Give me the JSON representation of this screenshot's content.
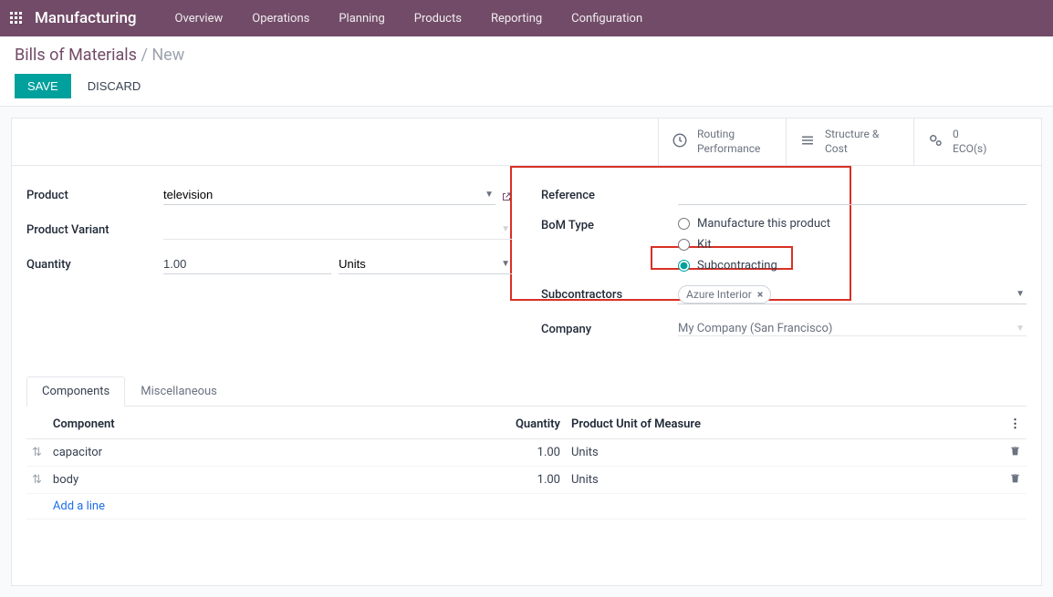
{
  "nav": {
    "brand": "Manufacturing",
    "items": [
      "Overview",
      "Operations",
      "Planning",
      "Products",
      "Reporting",
      "Configuration"
    ]
  },
  "breadcrumb": {
    "parent": "Bills of Materials",
    "current": "New"
  },
  "actions": {
    "save": "Save",
    "discard": "Discard"
  },
  "stats": {
    "routing": {
      "l1": "Routing",
      "l2": "Performance"
    },
    "structure": {
      "l1": "Structure &",
      "l2": "Cost"
    },
    "eco": {
      "l1": "0",
      "l2": "ECO(s)"
    }
  },
  "form": {
    "left": {
      "product_label": "Product",
      "product_value": "television",
      "variant_label": "Product Variant",
      "variant_value": "",
      "qty_label": "Quantity",
      "qty_value": "1.00",
      "qty_uom": "Units"
    },
    "right": {
      "reference_label": "Reference",
      "reference_value": "",
      "bomtype_label": "BoM Type",
      "bomtype_options": {
        "manufacture": "Manufacture this product",
        "kit": "Kit",
        "subcontracting": "Subcontracting"
      },
      "subcontractors_label": "Subcontractors",
      "subcontractors_tag": "Azure Interior",
      "company_label": "Company",
      "company_value": "My Company (San Francisco)"
    }
  },
  "tabs": {
    "components": "Components",
    "misc": "Miscellaneous"
  },
  "components": {
    "headers": {
      "component": "Component",
      "qty": "Quantity",
      "uom": "Product Unit of Measure"
    },
    "rows": [
      {
        "name": "capacitor",
        "qty": "1.00",
        "uom": "Units"
      },
      {
        "name": "body",
        "qty": "1.00",
        "uom": "Units"
      }
    ],
    "add": "Add a line"
  }
}
